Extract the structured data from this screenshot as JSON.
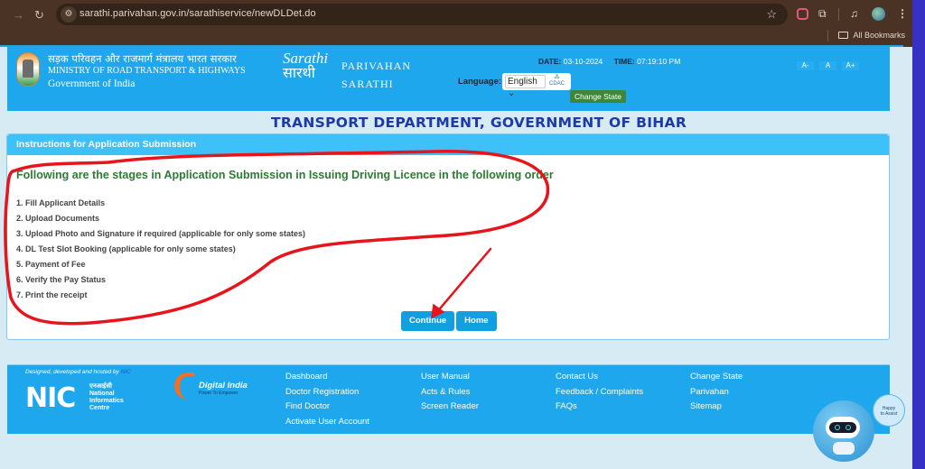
{
  "browser": {
    "url": "sarathi.parivahan.gov.in/sarathiservice/newDLDet.do",
    "bookmarks_label": "All Bookmarks"
  },
  "header": {
    "ministry_hindi": "सड़क परिवहन और राजमार्ग मंत्रालय भारत सरकार",
    "ministry_english": "MINISTRY OF ROAD TRANSPORT & HIGHWAYS",
    "government": "Government of India",
    "logo_line1": "Sarathi",
    "logo_line2": "सारथी",
    "parivahan": "PARIVAHAN",
    "sarathi": "SARATHI",
    "date_label": "DATE:",
    "date_value": "03-10-2024",
    "time_label": "TIME:",
    "time_value": "07:19:10 PM",
    "language_label": "Language:",
    "language_selected": "English",
    "cdac_label": "CDAC",
    "change_state_label": "Change State",
    "font_sizes": [
      "A-",
      "A",
      "A+"
    ]
  },
  "department_title": "TRANSPORT DEPARTMENT, GOVERNMENT OF BIHAR",
  "panel": {
    "header": "Instructions for Application Submission",
    "title": "Following are the stages in Application Submission in Issuing Driving Licence in the following order",
    "steps": [
      "1. Fill Applicant Details",
      "2. Upload Documents",
      "3. Upload Photo and Signature if required (applicable for only some states)",
      "4. DL Test Slot Booking (applicable for only some states)",
      "5. Payment of Fee",
      "6. Verify the Pay Status",
      "7. Print the receipt"
    ],
    "continue_label": "Continue",
    "home_label": "Home"
  },
  "footer": {
    "designed_by": "Designed, developed and hosted by",
    "designed_link": "NIC",
    "nic_hindi": "एनआईसी",
    "nic_lines": [
      "National",
      "Informatics",
      "Centre"
    ],
    "digital_india": "Digital India",
    "digital_india_tag": "Power To Empower",
    "columns": [
      [
        "Dashboard",
        "Doctor Registration",
        "Find Doctor",
        "Activate User Account"
      ],
      [
        "User Manual",
        "Acts & Rules",
        "Screen Reader"
      ],
      [
        "Contact Us",
        "Feedback / Complaints",
        "FAQs"
      ],
      [
        "Change State",
        "Parivahan",
        "Sitemap"
      ]
    ]
  },
  "chatbot": {
    "bubble_line1": "Happy",
    "bubble_line2": "to Assist"
  },
  "colors": {
    "header_blue": "#1ea7ec",
    "panel_head": "#3ec0f8",
    "title_green": "#2c7b32",
    "dept_blue": "#1e39a8",
    "button_blue": "#129fe0",
    "annotation_red": "#e8141c"
  }
}
